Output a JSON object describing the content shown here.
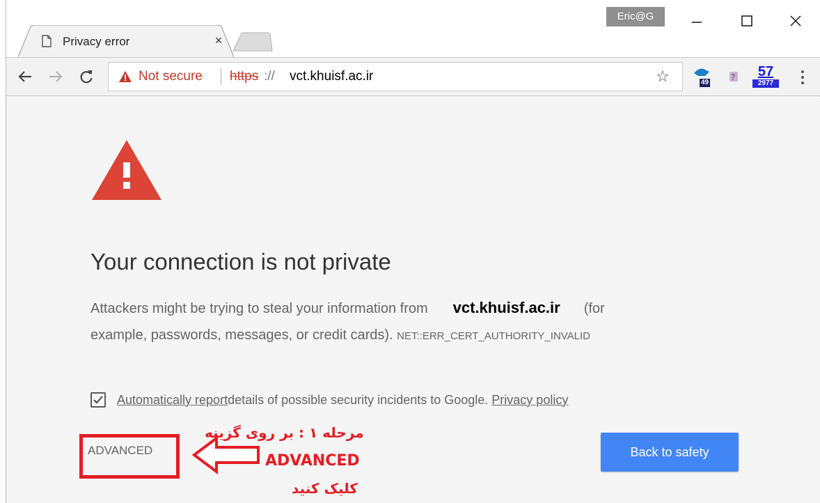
{
  "browser": {
    "tab": {
      "title": "Privacy error",
      "close_glyph": "×"
    },
    "profile_name": "Eric@G",
    "window_controls": {
      "minimize": "—",
      "maximize": "☐",
      "close": "✕"
    },
    "nav": {
      "back": "←",
      "forward": "→",
      "reload": "C"
    },
    "omnibox": {
      "security_label": "Not secure",
      "scheme": "https",
      "scheme_rest": "://",
      "host": "vct.khuisf.ac.ir",
      "star": "☆"
    },
    "extensions": [
      {
        "icon": "shield-ext-icon",
        "badge": "49"
      },
      {
        "icon": "puzzle-ext-icon"
      },
      {
        "icon": "counter-ext-icon",
        "top": "57",
        "bottom": "2977"
      }
    ]
  },
  "interstitial": {
    "heading": "Your connection is not private",
    "para_prefix": "Attackers might be trying to steal your information from",
    "domain": "vct.khuisf.ac.ir",
    "para_suffix_a": "(for",
    "para_line2": "example, passwords, messages, or credit cards).",
    "error_code": "NET::ERR_CERT_AUTHORITY_INVALID",
    "checkbox": {
      "checked": true,
      "link_text": "Automatically report",
      "rest_text": " details of possible security incidents to Google.",
      "privacy_link": "Privacy policy"
    },
    "advanced_label": "ADVANCED",
    "back_to_safety_label": "Back to safety"
  },
  "annotation": {
    "line1": "مرحله ۱ : بر روی گزینه",
    "line2": "ADVANCED",
    "line3": "کلیک کنید",
    "color": "#e31e24"
  },
  "colors": {
    "warning_red": "#db4437",
    "not_secure_red": "#c53929",
    "safety_blue": "#4285f4"
  }
}
